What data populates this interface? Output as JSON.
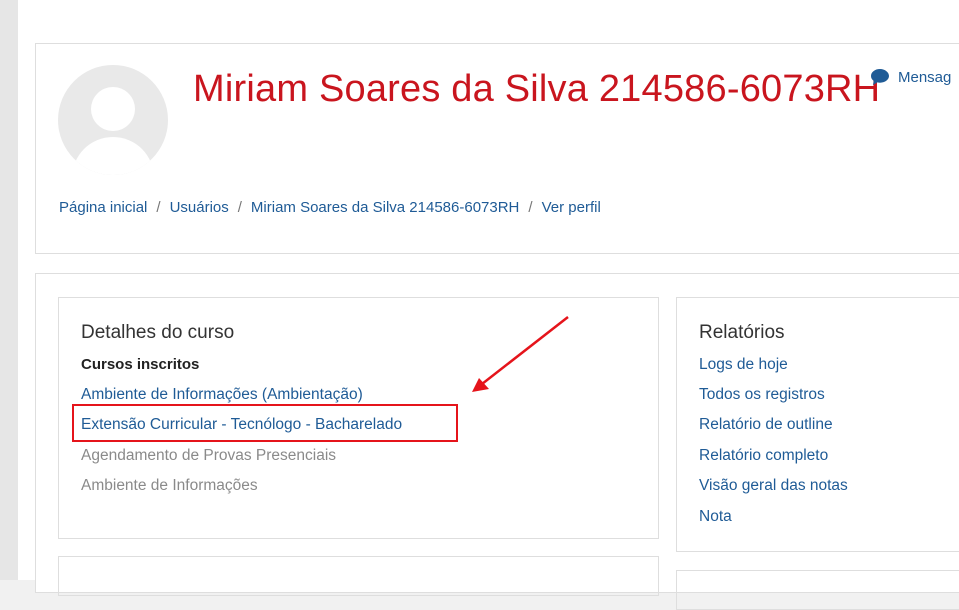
{
  "profile": {
    "name": "Miriam Soares da Silva 214586-6073RH",
    "message_label": "Mensag",
    "avatar_icon": "user-avatar-icon",
    "message_icon": "chat-bubble-icon"
  },
  "breadcrumb": [
    "Página inicial",
    "Usuários",
    "Miriam Soares da Silva 214586-6073RH",
    "Ver perfil"
  ],
  "course_details": {
    "title": "Detalhes do curso",
    "enrolled_label": "Cursos inscritos",
    "courses": [
      "Ambiente de Informações (Ambientação)",
      "Extensão Curricular - Tecnólogo - Bacharelado",
      "Agendamento de Provas Presenciais",
      "Ambiente de Informações"
    ]
  },
  "reports": {
    "title": "Relatórios",
    "items": [
      "Logs de hoje",
      "Todos os registros",
      "Relatório de outline",
      "Relatório completo",
      "Visão geral das notas",
      "Nota"
    ]
  },
  "colors": {
    "title_red": "#c9151e",
    "link_blue": "#1f5b96",
    "annotation_red": "#e5141b",
    "muted_gray": "#8a8a8a"
  }
}
